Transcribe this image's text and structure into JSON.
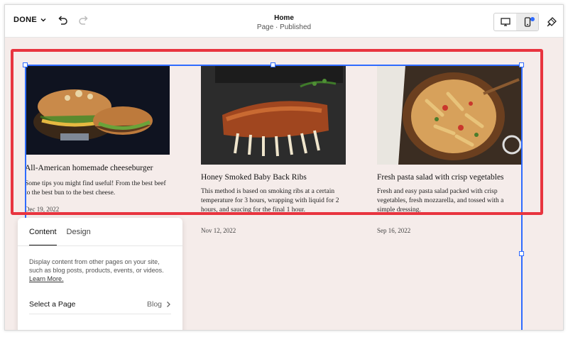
{
  "toolbar": {
    "done_label": "DONE",
    "page_title": "Home",
    "page_status": "Page · Published"
  },
  "posts": [
    {
      "title": "All-American homemade cheeseburger",
      "excerpt": "Some tips you might find useful! From the best beef to the best bun to the best cheese.",
      "date": "Dec 19, 2022"
    },
    {
      "title": "Honey Smoked Baby Back Ribs",
      "excerpt": "This method is based on smoking ribs at a certain temperature for 3 hours, wrapping with liquid for 2 hours, and saucing for the final 1 hour.",
      "date": "Nov 12, 2022"
    },
    {
      "title": "Fresh pasta salad with crisp vegetables",
      "excerpt": "Fresh and easy pasta salad packed with crisp vegetables, fresh mozzarella, and tossed with a simple dressing.",
      "date": "Sep 16, 2022"
    }
  ],
  "panel": {
    "tab_content": "Content",
    "tab_design": "Design",
    "description": "Display content from other pages on your site, such as blog posts, products, events, or videos.",
    "learn_more": "Learn More.",
    "select_label": "Select a Page",
    "select_value": "Blog"
  },
  "colors": {
    "accent_blue": "#2f6bff",
    "highlight_red": "#e8343f",
    "canvas_bg": "#f5ecea"
  },
  "icons": [
    "chevron-down-icon",
    "undo-icon",
    "redo-icon",
    "desktop-icon",
    "mobile-icon",
    "brush-icon",
    "chevron-right-icon"
  ]
}
